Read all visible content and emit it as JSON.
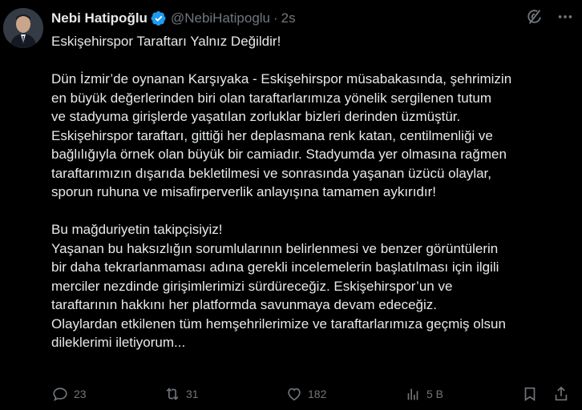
{
  "author": {
    "name": "Nebi Hatipoğlu",
    "handle": "@NebiHatipoglu",
    "separator": "·",
    "time": "2s",
    "verified_color": "#1d9bf0"
  },
  "tweet": {
    "title": "Eskişehirspor Taraftarı Yalnız Değildir!",
    "paragraph1": [
      "Dün İzmir’de oynanan Karşıyaka - Eskişehirspor müsabakasında, şehrimizin",
      "en büyük değerlerinden biri olan taraftarlarımıza yönelik sergilenen tutum",
      "ve stadyuma girişlerde yaşatılan zorluklar bizleri derinden üzmüştür.",
      "Eskişehirspor taraftarı, gittiği her deplasmana renk katan, centilmenliği ve",
      "bağlılığıyla örnek olan büyük bir camiadır. Stadyumda yer olmasına rağmen",
      "taraftarımızın dışarıda bekletilmesi ve sonrasında yaşanan üzücü olaylar,",
      "sporun ruhuna ve misafirperverlik anlayışına tamamen aykırıdır!"
    ],
    "paragraph2": [
      "Bu mağduriyetin takipçisiyiz!",
      "Yaşanan bu haksızlığın sorumlularının belirlenmesi ve benzer görüntülerin",
      "bir daha tekrarlanmaması adına gerekli incelemelerin başlatılması için ilgili",
      "merciler nezdinde girişimlerimizi sürdüreceğiz. Eskişehirspor’un ve",
      "taraftarının hakkını her platformda savunmaya devam edeceğiz.",
      "Olaylardan etkilenen tüm hemşehrilerimize ve taraftarlarımıza geçmiş olsun",
      "dileklerimi iletiyorum..."
    ]
  },
  "actions": {
    "replies": "23",
    "reposts": "31",
    "likes": "182",
    "views": "5 B"
  },
  "icons": [
    "grok-icon",
    "more-icon",
    "reply-icon",
    "repost-icon",
    "like-icon",
    "views-icon",
    "bookmark-icon",
    "share-icon"
  ]
}
